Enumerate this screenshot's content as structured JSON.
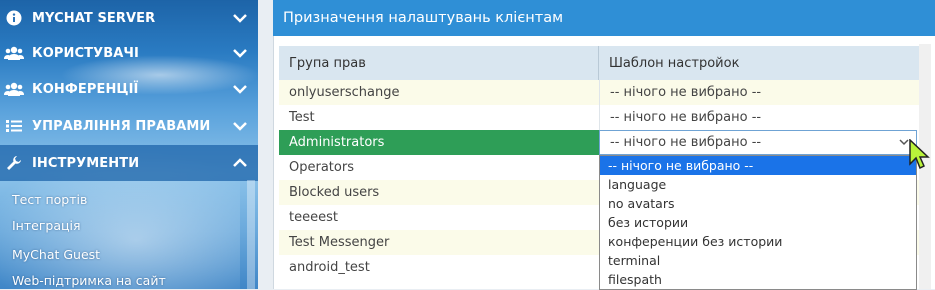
{
  "sidebar": {
    "menu": [
      {
        "label": "MYCHAT SERVER",
        "icon": "info-icon"
      },
      {
        "label": "КОРИСТУВАЧІ",
        "icon": "users-icon"
      },
      {
        "label": "КОНФЕРЕНЦІЇ",
        "icon": "conference-icon"
      },
      {
        "label": "УПРАВЛІННЯ ПРАВАМИ",
        "icon": "list-icon"
      },
      {
        "label": "ІНСТРУМЕНТИ",
        "icon": "wrench-icon"
      }
    ],
    "submenu": [
      "Тест портів",
      "Інтеграція",
      "MyChat Guest",
      "Web-підтримка на сайт"
    ]
  },
  "panel": {
    "title": "Призначення налаштувань клієнтам",
    "columns": [
      "Група прав",
      "Шаблон настройок"
    ],
    "rows": [
      {
        "group": "onlyuserschange",
        "template": "-- нічого не вибрано --"
      },
      {
        "group": "Test",
        "template": "-- нічого не вибрано --"
      },
      {
        "group": "Administrators",
        "template": "-- нічого не вибрано --"
      },
      {
        "group": "Operators",
        "template": ""
      },
      {
        "group": "Blocked users",
        "template": ""
      },
      {
        "group": "teeeest",
        "template": ""
      },
      {
        "group": "Test Messenger",
        "template": ""
      },
      {
        "group": "android_test",
        "template": ""
      }
    ],
    "dropdown_options": [
      "-- нічого не вибрано --",
      "language",
      "no avatars",
      "без истории",
      "конференции без истории",
      "terminal",
      "filespath"
    ]
  },
  "colors": {
    "header_blue": "#2f8fd6",
    "selected_green": "#2e9e57",
    "option_highlight": "#1a73e8",
    "row_alt": "#fbfbe9"
  }
}
